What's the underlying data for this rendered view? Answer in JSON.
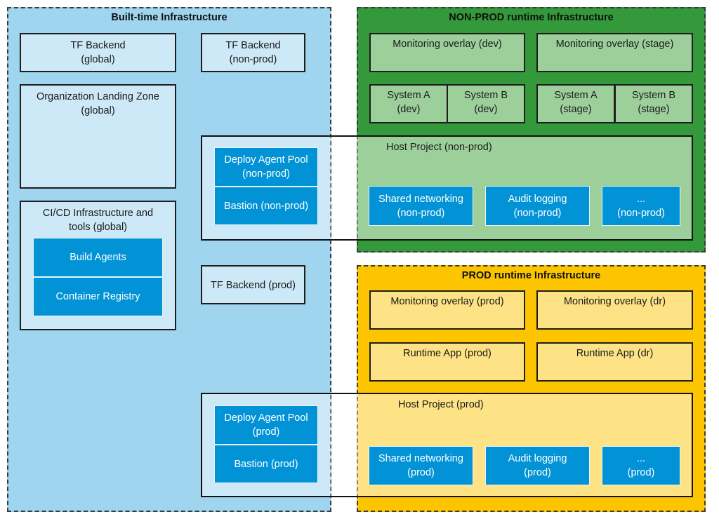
{
  "colors": {
    "built_time_bg": "#9fd5ef",
    "nonprod_bg": "#33993a",
    "prod_bg": "#fcc500",
    "service_blue": "#0293d6",
    "light_blue": "#cde9f7",
    "light_green": "#9dcf9b",
    "light_yellow": "#fde385"
  },
  "built_time": {
    "title": "Built-time Infrastructure",
    "tf_backend_global": [
      "TF Backend",
      "(global)"
    ],
    "tf_backend_nonprod": [
      "TF Backend",
      "(non-prod)"
    ],
    "tf_backend_prod": "TF Backend (prod)",
    "landing_zone": [
      "Organization Landing Zone",
      "(global)"
    ],
    "cicd": {
      "title": [
        "CI/CD Infrastructure and",
        "tools (global)"
      ],
      "items": [
        "Build Agents",
        "Container Registry"
      ]
    },
    "deploy_nonprod": {
      "agent_pool": [
        "Deploy Agent Pool",
        "(non-prod)"
      ],
      "bastion": "Bastion (non-prod)"
    },
    "deploy_prod": {
      "agent_pool": [
        "Deploy Agent Pool",
        "(prod)"
      ],
      "bastion": "Bastion (prod)"
    }
  },
  "nonprod": {
    "title": "NON-PROD runtime Infrastructure",
    "monitoring": [
      "Monitoring overlay (dev)",
      "Monitoring overlay (stage)"
    ],
    "systems": [
      [
        "System A",
        "(dev)"
      ],
      [
        "System B",
        "(dev)"
      ],
      [
        "System A",
        "(stage)"
      ],
      [
        "System B",
        "(stage)"
      ]
    ],
    "host_project": {
      "title": "Host Project (non-prod)",
      "services": [
        [
          "Shared networking",
          "(non-prod)"
        ],
        [
          "Audit logging",
          "(non-prod)"
        ],
        [
          "...",
          "(non-prod)"
        ]
      ]
    }
  },
  "prod": {
    "title": "PROD runtime Infrastructure",
    "monitoring": [
      "Monitoring overlay (prod)",
      "Monitoring overlay (dr)"
    ],
    "runtime_apps": [
      "Runtime App (prod)",
      "Runtime App (dr)"
    ],
    "host_project": {
      "title": "Host Project (prod)",
      "services": [
        [
          "Shared networking",
          "(prod)"
        ],
        [
          "Audit logging",
          "(prod)"
        ],
        [
          "...",
          "(prod)"
        ]
      ]
    }
  }
}
